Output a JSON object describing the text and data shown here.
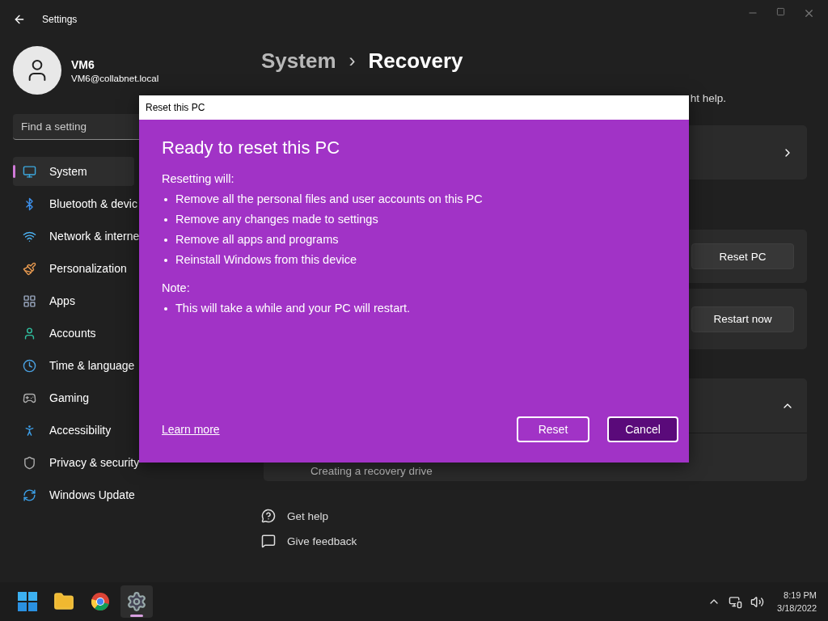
{
  "window": {
    "title": "Settings"
  },
  "user": {
    "name": "VM6",
    "email": "VM6@collabnet.local"
  },
  "search": {
    "placeholder": "Find a setting"
  },
  "nav": [
    {
      "label": "System",
      "selected": true
    },
    {
      "label": "Bluetooth & devic",
      "selected": false
    },
    {
      "label": "Network & interne",
      "selected": false
    },
    {
      "label": "Personalization",
      "selected": false
    },
    {
      "label": "Apps",
      "selected": false
    },
    {
      "label": "Accounts",
      "selected": false
    },
    {
      "label": "Time & language",
      "selected": false
    },
    {
      "label": "Gaming",
      "selected": false
    },
    {
      "label": "Accessibility",
      "selected": false
    },
    {
      "label": "Privacy & security",
      "selected": false
    },
    {
      "label": "Windows Update",
      "selected": false
    }
  ],
  "breadcrumb": {
    "parent": "System",
    "separator": "›",
    "current": "Recovery"
  },
  "description": "ht help.",
  "cards": [
    {
      "kind": "link"
    },
    {
      "kind": "button",
      "button": "Reset PC"
    },
    {
      "kind": "button",
      "button": "Restart now"
    },
    {
      "kind": "expander",
      "expanded": true,
      "child": "Creating a recovery drive"
    }
  ],
  "help_links": [
    "Get help",
    "Give feedback"
  ],
  "dialog": {
    "title": "Reset this PC",
    "heading": "Ready to reset this PC",
    "intro": "Resetting will:",
    "bullets": [
      "Remove all the personal files and user accounts on this PC",
      "Remove any changes made to settings",
      "Remove all apps and programs",
      "Reinstall Windows from this device"
    ],
    "note_label": "Note:",
    "note_bullets": [
      "This will take a while and your PC will restart."
    ],
    "learn_more": "Learn more",
    "buttons": [
      {
        "label": "Reset",
        "default": false
      },
      {
        "label": "Cancel",
        "default": true
      }
    ]
  },
  "taskbar": {
    "apps": [
      {
        "kind": "start",
        "active": false
      },
      {
        "kind": "folder",
        "active": false
      },
      {
        "kind": "browser",
        "active": false
      },
      {
        "kind": "settings",
        "active": true
      }
    ],
    "time": "8:19 PM",
    "date": "3/18/2022"
  }
}
